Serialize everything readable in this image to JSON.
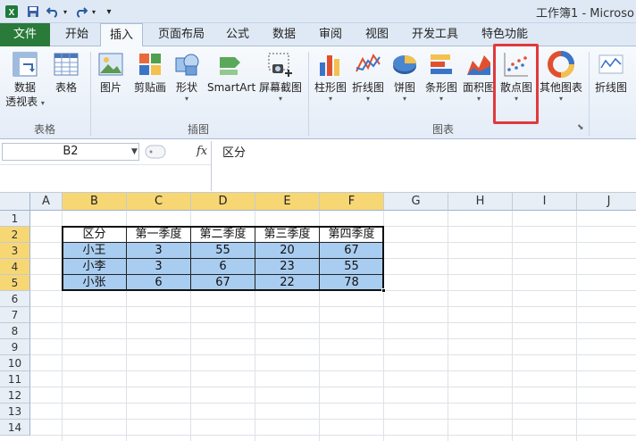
{
  "window": {
    "title": "工作簿1 - Microso"
  },
  "tabs": [
    {
      "label": "文件"
    },
    {
      "label": "开始"
    },
    {
      "label": "插入"
    },
    {
      "label": "页面布局"
    },
    {
      "label": "公式"
    },
    {
      "label": "数据"
    },
    {
      "label": "审阅"
    },
    {
      "label": "视图"
    },
    {
      "label": "开发工具"
    },
    {
      "label": "特色功能"
    }
  ],
  "active_tab": "插入",
  "ribbon": {
    "groups": {
      "tables": "表格",
      "illustrations": "插图",
      "charts": "图表"
    },
    "buttons": {
      "pivot_line1": "数据",
      "pivot_line2": "透视表",
      "table": "表格",
      "picture": "图片",
      "clipart": "剪贴画",
      "shapes": "形状",
      "smartart": "SmartArt",
      "screenshot": "屏幕截图",
      "column": "柱形图",
      "line": "折线图",
      "pie": "饼图",
      "bar": "条形图",
      "area": "面积图",
      "scatter": "散点图",
      "other": "其他图表",
      "sparkline_line": "折线图"
    },
    "caret": "▾"
  },
  "formula_bar": {
    "name_box": "B2",
    "fx": "fx",
    "content": "区分"
  },
  "sheet": {
    "columns": [
      "A",
      "B",
      "C",
      "D",
      "E",
      "F",
      "G",
      "H",
      "I",
      "J"
    ],
    "rows": [
      "1",
      "2",
      "3",
      "4",
      "5",
      "6",
      "7",
      "8",
      "9",
      "10",
      "11",
      "12",
      "13",
      "14"
    ],
    "table": {
      "headers": [
        "区分",
        "第一季度",
        "第二季度",
        "第三季度",
        "第四季度"
      ],
      "rows": [
        [
          "小王",
          "3",
          "55",
          "20",
          "67"
        ],
        [
          "小李",
          "3",
          "6",
          "23",
          "55"
        ],
        [
          "小张",
          "6",
          "67",
          "22",
          "78"
        ]
      ]
    }
  },
  "colors": {
    "file_tab": "#2a7a3a",
    "selection_header": "#f7d774",
    "data_fill": "#a9cdf0",
    "highlight": "#e0393e"
  }
}
